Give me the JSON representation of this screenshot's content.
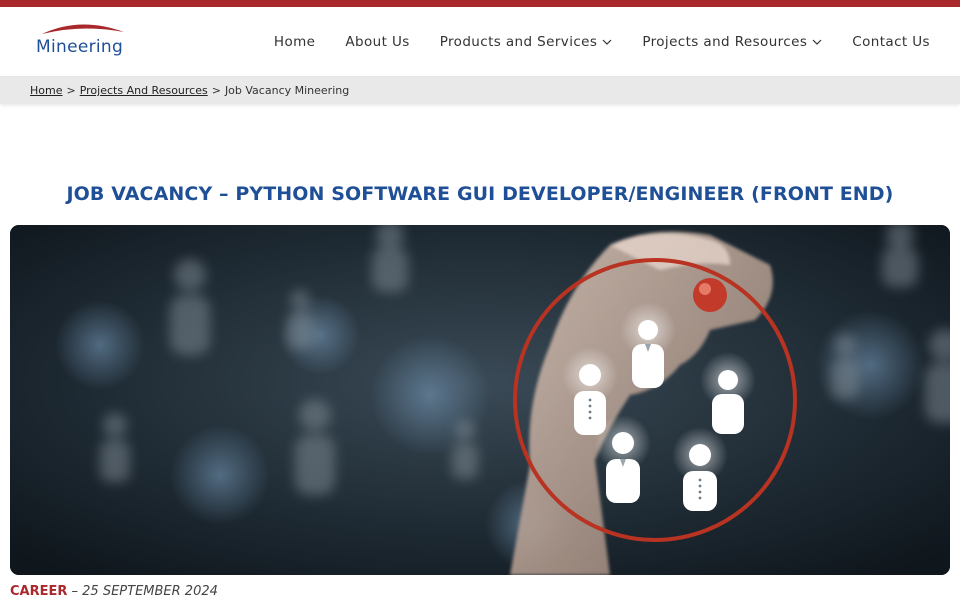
{
  "colors": {
    "accent_red": "#a8282c",
    "brand_blue": "#1f4f96",
    "title_blue": "#1f4f96"
  },
  "brand": {
    "name": "Mineering"
  },
  "nav": {
    "items": [
      {
        "label": "Home",
        "has_dropdown": false
      },
      {
        "label": "About Us",
        "has_dropdown": false
      },
      {
        "label": "Products and Services",
        "has_dropdown": true,
        "icon": "chevron-down-icon"
      },
      {
        "label": "Projects and Resources",
        "has_dropdown": true,
        "icon": "chevron-down-icon"
      },
      {
        "label": "Contact Us",
        "has_dropdown": false
      }
    ]
  },
  "breadcrumb": {
    "home": "Home",
    "sep1": ">",
    "section": "Projects And Resources",
    "sep2": ">",
    "current": "Job Vacancy Mineering"
  },
  "article": {
    "title": "JOB VACANCY – PYTHON SOFTWARE GUI DEVELOPER/ENGINEER (FRONT END)",
    "category": "CAREER",
    "separator": " – ",
    "date": "25 SEPTEMBER 2024",
    "hero_icon": "people-selection-icon"
  }
}
